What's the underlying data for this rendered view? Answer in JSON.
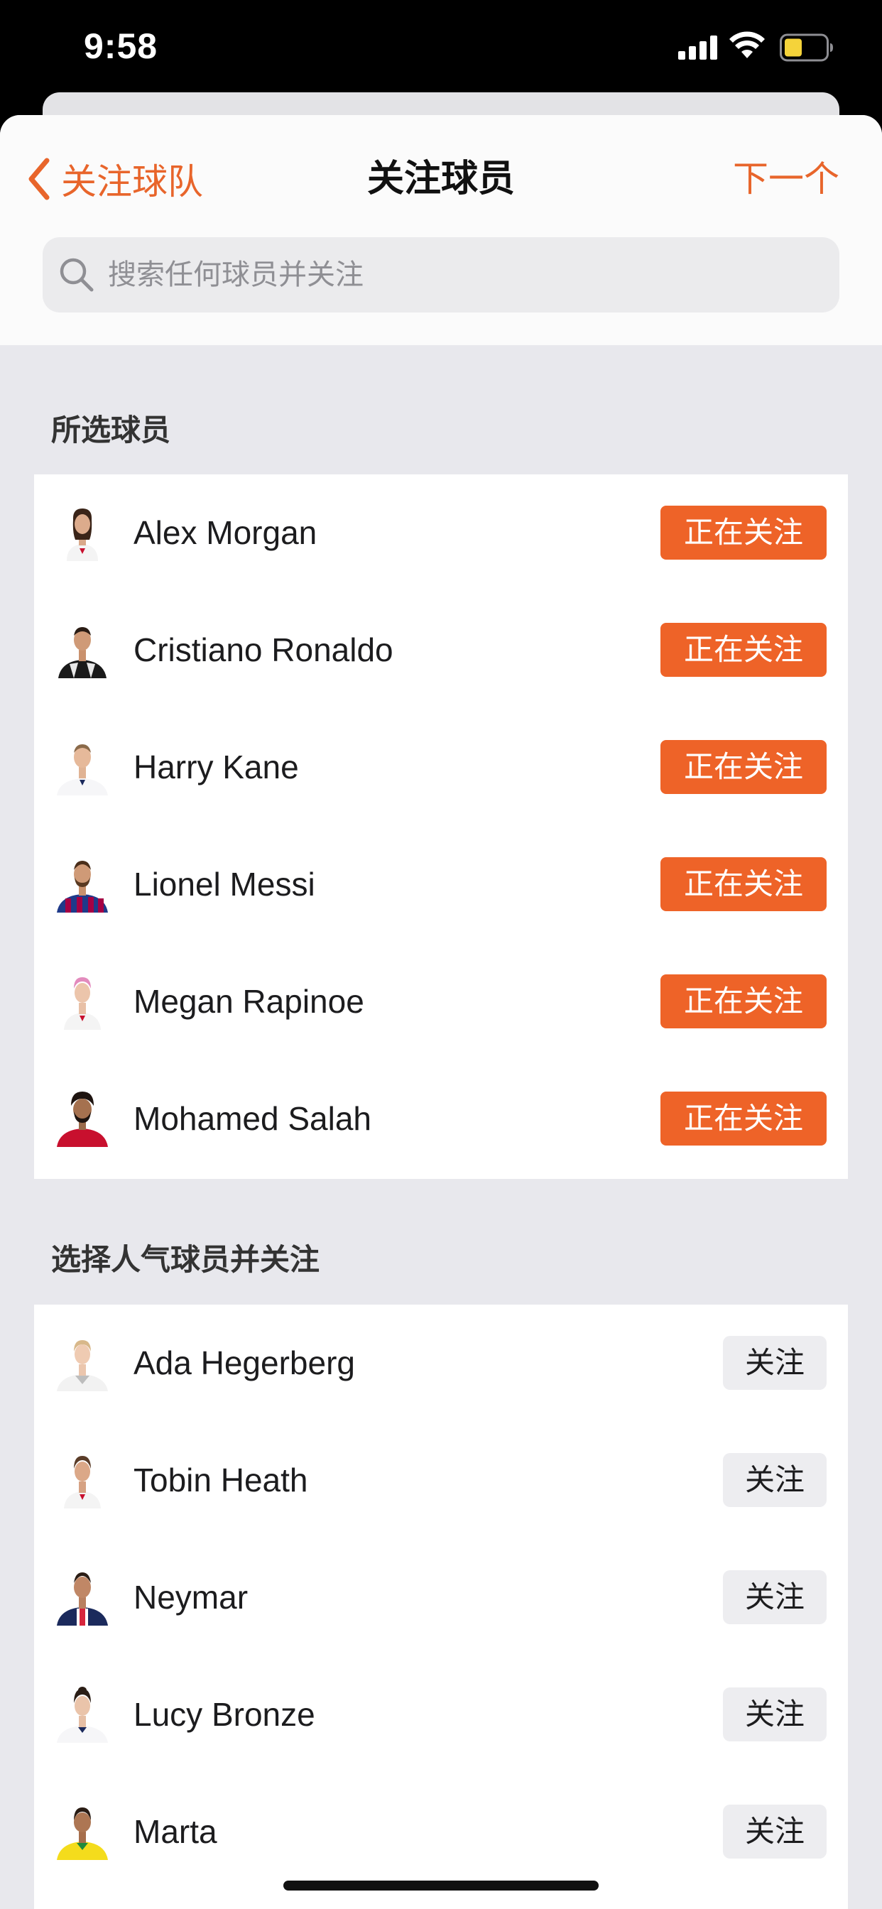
{
  "status_bar": {
    "time": "9:58",
    "icons": [
      "cellular-signal-icon",
      "wifi-icon",
      "battery-icon"
    ],
    "battery_color": "#f5d33a"
  },
  "nav": {
    "back_label": "关注球队",
    "title": "关注球员",
    "next_label": "下一个"
  },
  "search": {
    "placeholder": "搜索任何球员并关注",
    "value": ""
  },
  "colors": {
    "accent": "#ee6328",
    "follow_button_bg": "#ededf0"
  },
  "selected_section": {
    "title": "所选球员",
    "button_label": "正在关注",
    "players": [
      {
        "name": "Alex Morgan"
      },
      {
        "name": "Cristiano Ronaldo"
      },
      {
        "name": "Harry Kane"
      },
      {
        "name": "Lionel Messi"
      },
      {
        "name": "Megan Rapinoe"
      },
      {
        "name": "Mohamed Salah"
      }
    ]
  },
  "popular_section": {
    "title": "选择人气球员并关注",
    "button_label": "关注",
    "players": [
      {
        "name": "Ada Hegerberg"
      },
      {
        "name": "Tobin Heath"
      },
      {
        "name": "Neymar"
      },
      {
        "name": "Lucy Bronze"
      },
      {
        "name": "Marta"
      }
    ]
  }
}
